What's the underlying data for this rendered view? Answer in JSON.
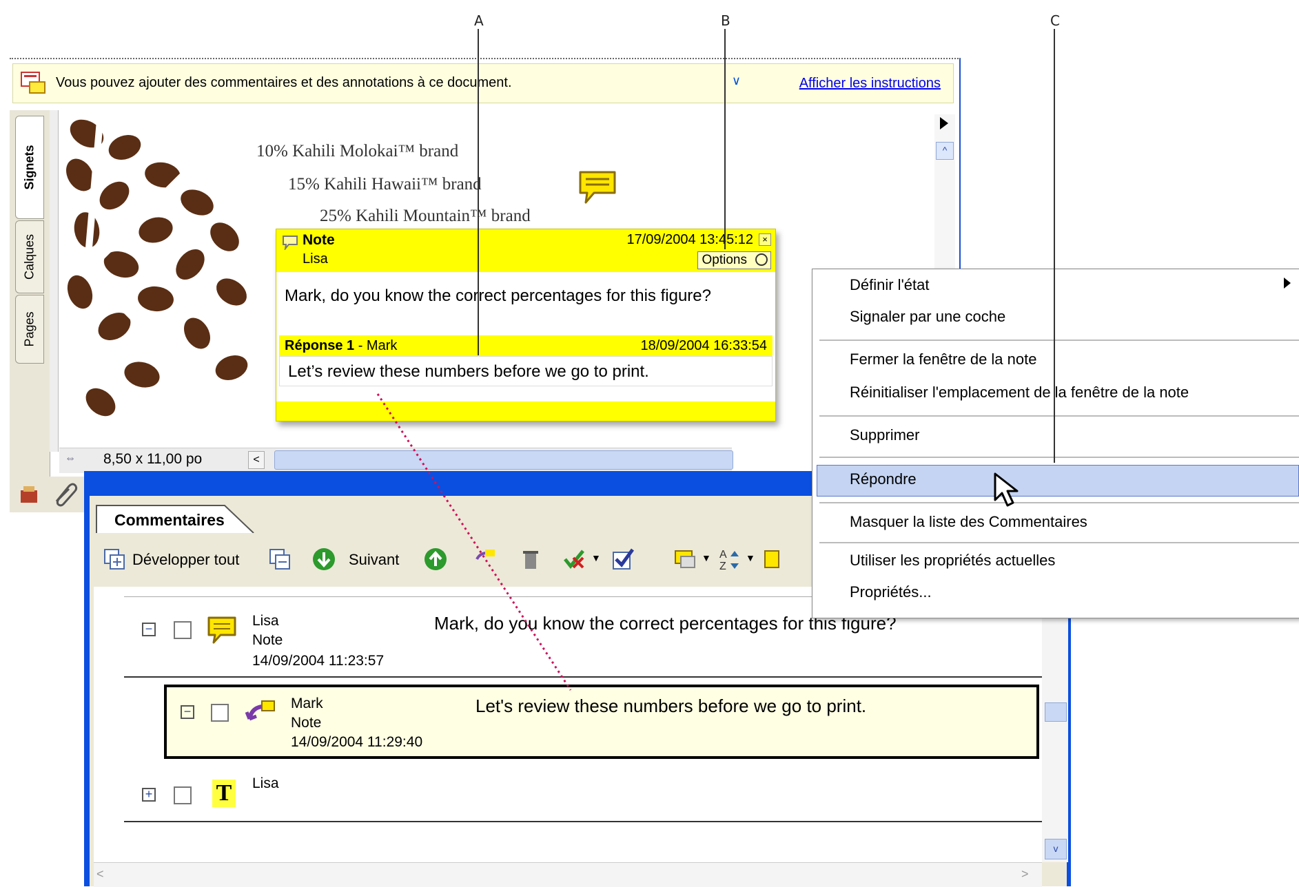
{
  "callouts": {
    "a": "A",
    "b": "B",
    "c": "C"
  },
  "message_bar": {
    "text": "Vous pouvez ajouter des commentaires et des annotations à ce document.",
    "link": "Afficher les instructions"
  },
  "side_tabs": [
    "Signets",
    "Calques",
    "Pages"
  ],
  "document": {
    "lines": [
      "10% Kahili Molokai™ brand",
      "15% Kahili Hawaii™ brand",
      "25% Kahili Mountain™ brand"
    ],
    "page_size": "8,50 x 11,00 po"
  },
  "note_popup": {
    "title": "Note",
    "author": "Lisa",
    "date": "17/09/2004 13:45:12",
    "options_label": "Options",
    "text": "Mark, do you know the correct percentages for this figure?",
    "reply_title": "Réponse 1",
    "reply_author": " - Mark",
    "reply_date": "18/09/2004 16:33:54",
    "reply_text": "Let’s review these numbers before we go to print."
  },
  "comments_panel": {
    "tab_label": "Commentaires",
    "toolbar": {
      "expand_all": "Développer tout",
      "next": "Suivant"
    },
    "rows": [
      {
        "author": "Lisa",
        "type": "Note",
        "date": "14/09/2004 11:23:57",
        "text": "Mark, do you know the correct percentages for this figure?"
      },
      {
        "author": "Mark",
        "type": "Note",
        "date": "14/09/2004 11:29:40",
        "text": "Let's review these numbers before we go to print."
      },
      {
        "author": "Lisa"
      }
    ]
  },
  "context_menu": {
    "items": [
      "Définir l'état",
      "Signaler par une coche",
      "Fermer la fenêtre de la note",
      "Réinitialiser l'emplacement de la fenêtre de la note",
      "Supprimer",
      "Répondre",
      "Masquer la liste des Commentaires",
      "Utiliser les propriétés actuelles",
      "Propriétés..."
    ],
    "highlighted": "Répondre"
  },
  "colors": {
    "note_yellow": "#ffff00",
    "window_blue": "#0a4fe0",
    "menu_highlight": "#c4d4f2"
  }
}
